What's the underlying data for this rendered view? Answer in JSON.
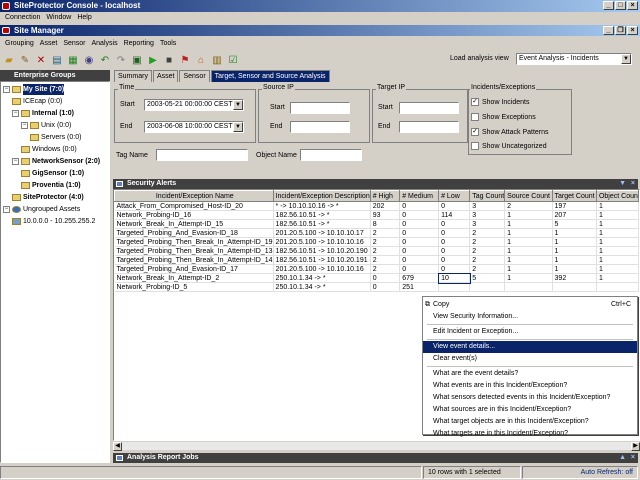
{
  "app": {
    "title": "SiteProtector Console - localhost",
    "menu": [
      "Connection",
      "Window",
      "Help"
    ]
  },
  "site_manager": {
    "title": "Site Manager",
    "menu": [
      "Grouping",
      "Asset",
      "Sensor",
      "Analysis",
      "Reporting",
      "Tools"
    ],
    "load_view_label": "Load analysis view",
    "load_view_value": "Event Analysis - Incidents"
  },
  "toolbar_icons": [
    "open-folder-icon",
    "edit-icon",
    "delete-icon",
    "group-icon",
    "chart-icon",
    "sensor-icon",
    "back-icon",
    "forward-icon",
    "save-icon",
    "play-icon",
    "stop-icon",
    "flag-icon",
    "home-icon",
    "report-icon",
    "check-icon"
  ],
  "groups": {
    "title": "Enterprise Groups",
    "items": [
      {
        "label": "My Site (7:0)",
        "bold": true,
        "level": 0
      },
      {
        "label": "ICEcap (0:0)",
        "bold": false,
        "level": 1
      },
      {
        "label": "Internal (1:0)",
        "bold": true,
        "level": 1
      },
      {
        "label": "Unix (0:0)",
        "bold": false,
        "level": 2
      },
      {
        "label": "Servers (0:0)",
        "bold": false,
        "level": 3
      },
      {
        "label": "Windows (0:0)",
        "bold": false,
        "level": 2
      },
      {
        "label": "NetworkSensor (2:0)",
        "bold": true,
        "level": 1
      },
      {
        "label": "GigSensor (1:0)",
        "bold": true,
        "level": 2
      },
      {
        "label": "Proventia (1:0)",
        "bold": true,
        "level": 2
      },
      {
        "label": "SiteProtector (4:0)",
        "bold": true,
        "level": 1
      },
      {
        "label": "Ungrouped Assets",
        "bold": false,
        "level": 0
      },
      {
        "label": "10.0.0.0 - 10.255.255.2",
        "bold": false,
        "level": 1
      }
    ]
  },
  "tabs": [
    {
      "label": "Summary",
      "active": false
    },
    {
      "label": "Asset",
      "active": false
    },
    {
      "label": "Sensor",
      "active": false
    },
    {
      "label": "Target, Sensor and Source Analysis",
      "active": true
    }
  ],
  "filters": {
    "time_label": "Time",
    "start_label": "Start",
    "end_label": "End",
    "start_value": "2003-05-21 00:00:00 CEST",
    "end_value": "2003-06-08 10:00:00 CEST",
    "source_ip_label": "Source IP",
    "target_ip_label": "Target IP",
    "ip_start_label": "Start",
    "ip_end_label": "End",
    "incidents_label": "Incidents/Exceptions",
    "checkboxes": [
      {
        "label": "Show Incidents",
        "checked": true
      },
      {
        "label": "Show Exceptions",
        "checked": false
      },
      {
        "label": "Show Attack Patterns",
        "checked": true
      },
      {
        "label": "Show Uncategorized",
        "checked": false
      }
    ],
    "tag_name_label": "Tag Name",
    "object_name_label": "Object Name"
  },
  "alerts": {
    "title": "Security Alerts",
    "columns": [
      "Incident/Exception Name",
      "Incident/Exception Description",
      "# High",
      "# Medium",
      "# Low",
      "Tag Count",
      "Source Count",
      "Target Count",
      "Object Coun"
    ],
    "rows": [
      [
        "Attack_From_Compromised_Host-ID_20",
        "* -> 10.10.10.16 -> *",
        "202",
        "0",
        "0",
        "3",
        "2",
        "197",
        "1"
      ],
      [
        "Network_Probing-ID_16",
        "182.56.10.51 -> *",
        "93",
        "0",
        "114",
        "3",
        "1",
        "207",
        "1"
      ],
      [
        "Network_Break_In_Attempt-ID_15",
        "182.56.10.51 -> *",
        "8",
        "0",
        "0",
        "3",
        "1",
        "5",
        "1"
      ],
      [
        "Targeted_Probing_And_Evasion-ID_18",
        "201.20.5.100 -> 10.10.10.17",
        "2",
        "0",
        "0",
        "2",
        "1",
        "1",
        "1"
      ],
      [
        "Targeted_Probing_Then_Break_In_Attempt-ID_19",
        "201.20.5.100 -> 10.10.10.16",
        "2",
        "0",
        "0",
        "2",
        "1",
        "1",
        "1"
      ],
      [
        "Targeted_Probing_Then_Break_In_Attempt-ID_13",
        "182.56.10.51 -> 10.10.20.190",
        "2",
        "0",
        "0",
        "2",
        "1",
        "1",
        "1"
      ],
      [
        "Targeted_Probing_Then_Break_In_Attempt-ID_14",
        "182.56.10.51 -> 10.10.20.191",
        "2",
        "0",
        "0",
        "2",
        "1",
        "1",
        "1"
      ],
      [
        "Targeted_Probing_And_Evasion-ID_17",
        "201.20.5.100 -> 10.10.10.16",
        "2",
        "0",
        "0",
        "2",
        "1",
        "1",
        "1"
      ],
      [
        "Network_Break_In_Attempt-ID_2",
        "250.10.1.34 -> *",
        "0",
        "679",
        "10",
        "5",
        "1",
        "392",
        "1"
      ],
      [
        "Network_Probing-ID_5",
        "250.10.1.34 -> *",
        "0",
        "251",
        "",
        "",
        "",
        "",
        ""
      ]
    ]
  },
  "context_menu": {
    "items": [
      {
        "label": "Copy",
        "shortcut": "Ctrl+C",
        "highlighted": false,
        "sep_after": false,
        "icon": true
      },
      {
        "label": "View Security Information...",
        "shortcut": "",
        "highlighted": false,
        "sep_after": true
      },
      {
        "label": "Edit Incident or Exception...",
        "shortcut": "",
        "highlighted": false,
        "sep_after": true
      },
      {
        "label": "View event details...",
        "shortcut": "",
        "highlighted": true,
        "sep_after": false
      },
      {
        "label": "Clear event(s)",
        "shortcut": "",
        "highlighted": false,
        "sep_after": true
      },
      {
        "label": "What are the event details?",
        "shortcut": "",
        "highlighted": false,
        "sep_after": false
      },
      {
        "label": "What events are in this Incident/Exception?",
        "shortcut": "",
        "highlighted": false,
        "sep_after": false
      },
      {
        "label": "What sensors detected events in this Incident/Exception?",
        "shortcut": "",
        "highlighted": false,
        "sep_after": false
      },
      {
        "label": "What sources are in this Incident/Exception?",
        "shortcut": "",
        "highlighted": false,
        "sep_after": false
      },
      {
        "label": "What target objects are in this Incident/Exception?",
        "shortcut": "",
        "highlighted": false,
        "sep_after": false
      },
      {
        "label": "What targets are in this Incident/Exception?",
        "shortcut": "",
        "highlighted": false,
        "sep_after": false
      }
    ]
  },
  "report_jobs": {
    "title": "Analysis Report Jobs"
  },
  "status": {
    "rows_selected": "10 rows with 1 selected",
    "auto_refresh": "Auto Refresh: off"
  },
  "colors": {
    "titlebar": "#0a246a",
    "highlight": "#0a246a",
    "panel_head": "#404040"
  }
}
